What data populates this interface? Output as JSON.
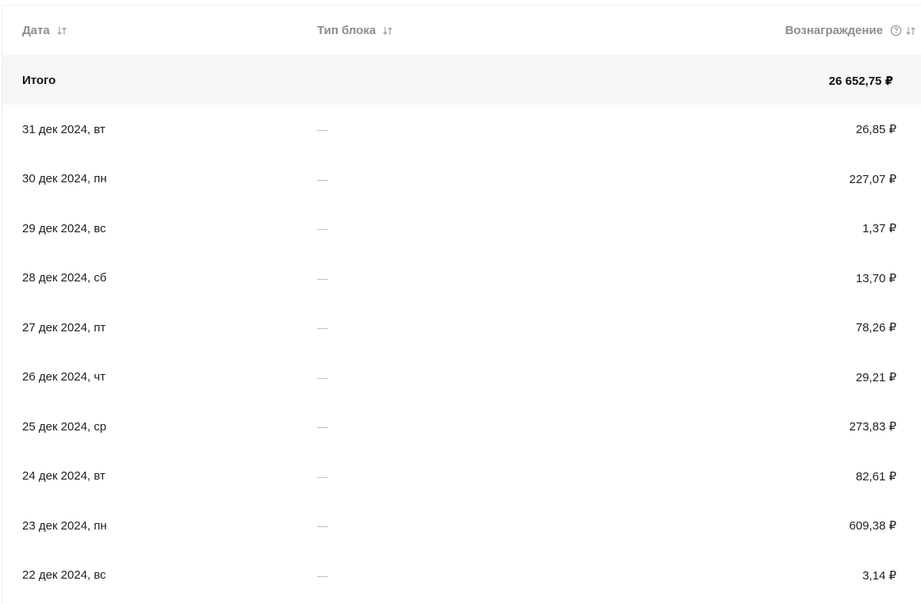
{
  "table": {
    "headers": {
      "date": "Дата",
      "block_type": "Тип блока",
      "reward": "Вознаграждение"
    },
    "total": {
      "label": "Итого",
      "reward": "26 652,75 ₽"
    },
    "rows": [
      {
        "date": "31 дек 2024, вт",
        "block_type": "—",
        "reward": "26,85 ₽"
      },
      {
        "date": "30 дек 2024, пн",
        "block_type": "—",
        "reward": "227,07 ₽"
      },
      {
        "date": "29 дек 2024, вс",
        "block_type": "—",
        "reward": "1,37 ₽"
      },
      {
        "date": "28 дек 2024, сб",
        "block_type": "—",
        "reward": "13,70 ₽"
      },
      {
        "date": "27 дек 2024, пт",
        "block_type": "—",
        "reward": "78,26 ₽"
      },
      {
        "date": "26 дек 2024, чт",
        "block_type": "—",
        "reward": "29,21 ₽"
      },
      {
        "date": "25 дек 2024, ср",
        "block_type": "—",
        "reward": "273,83 ₽"
      },
      {
        "date": "24 дек 2024, вт",
        "block_type": "—",
        "reward": "82,61 ₽"
      },
      {
        "date": "23 дек 2024, пн",
        "block_type": "—",
        "reward": "609,38 ₽"
      },
      {
        "date": "22 дек 2024, вс",
        "block_type": "—",
        "reward": "3,14 ₽"
      }
    ],
    "icons": {
      "sort": "sort-arrows-icon",
      "help": "question-circle-icon"
    }
  }
}
